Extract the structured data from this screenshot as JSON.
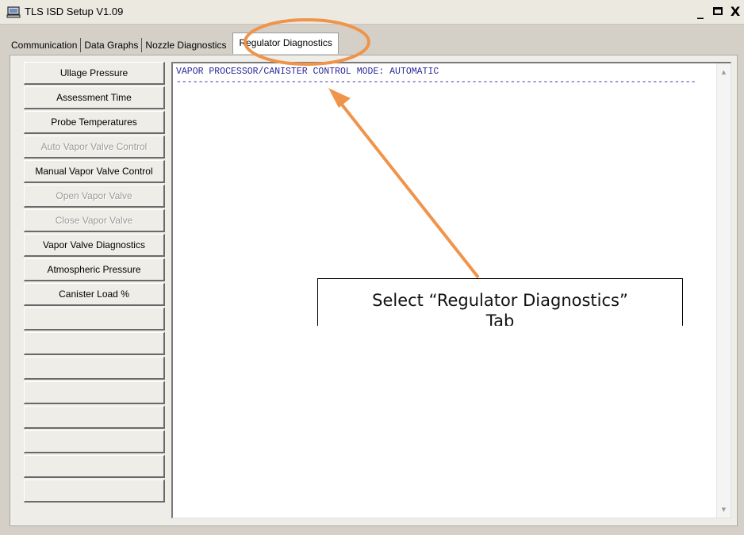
{
  "window": {
    "title": "TLS ISD Setup V1.09",
    "controls": [
      "_",
      "□",
      "X"
    ]
  },
  "tabs": [
    {
      "label": "Communication",
      "active": false
    },
    {
      "label": "Data Graphs",
      "active": false
    },
    {
      "label": "Nozzle Diagnostics",
      "active": false
    },
    {
      "label": "Regulator Diagnostics",
      "active": true
    }
  ],
  "buttons": [
    {
      "label": "Ullage Pressure",
      "enabled": true
    },
    {
      "label": "Assessment Time",
      "enabled": true
    },
    {
      "label": "Probe Temperatures",
      "enabled": true
    },
    {
      "label": "Auto Vapor Valve Control",
      "enabled": false
    },
    {
      "label": "Manual Vapor Valve Control",
      "enabled": true
    },
    {
      "label": "Open Vapor Valve",
      "enabled": false
    },
    {
      "label": "Close Vapor Valve",
      "enabled": false
    },
    {
      "label": "Vapor Valve Diagnostics",
      "enabled": true
    },
    {
      "label": "Atmospheric Pressure",
      "enabled": true
    },
    {
      "label": "Canister Load %",
      "enabled": true
    },
    {
      "label": "",
      "enabled": true
    },
    {
      "label": "",
      "enabled": true
    },
    {
      "label": "",
      "enabled": true
    },
    {
      "label": "",
      "enabled": true
    },
    {
      "label": "",
      "enabled": true
    },
    {
      "label": "",
      "enabled": true
    },
    {
      "label": "",
      "enabled": true
    },
    {
      "label": "",
      "enabled": true
    }
  ],
  "output": {
    "line1": "VAPOR PROCESSOR/CANISTER CONTROL MODE: AUTOMATIC",
    "line2": "-----------------------------------------------------------------------------------------------"
  },
  "annotation": {
    "callout_text": "Select “Regulator Diagnostics”",
    "callout_text_line2": "Tab",
    "accent_color": "#f0944a"
  }
}
